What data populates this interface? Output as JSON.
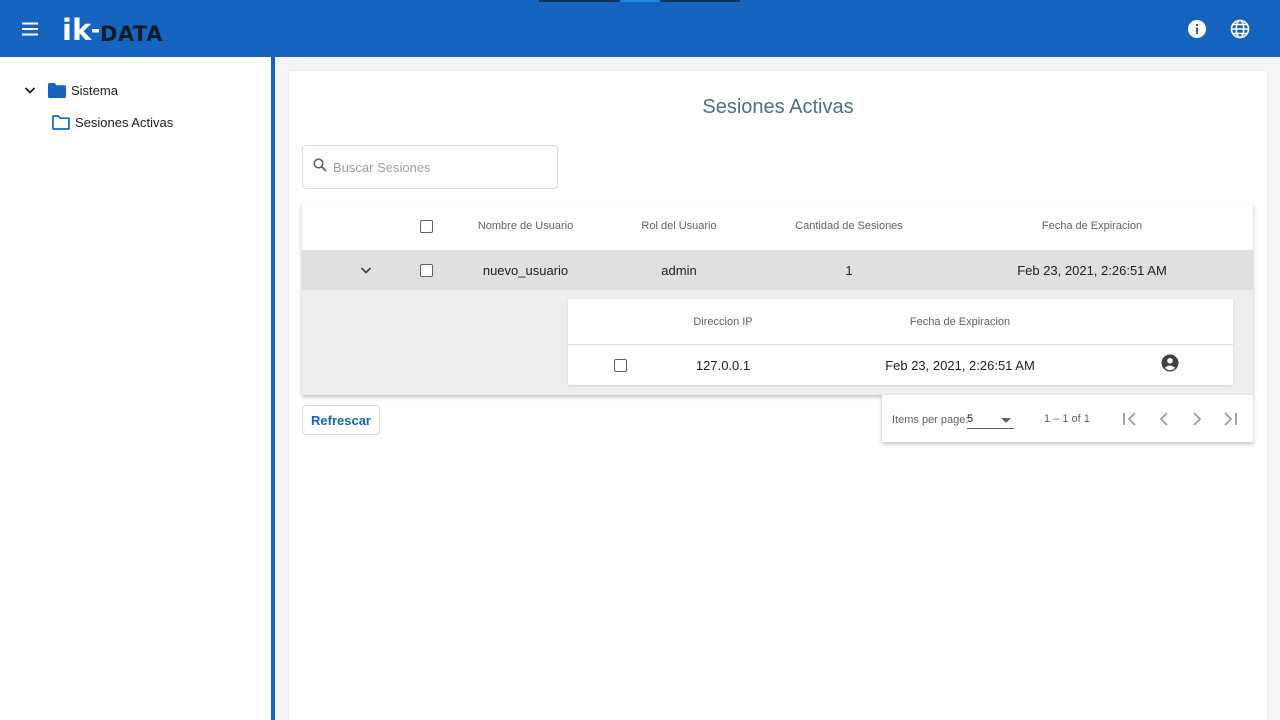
{
  "app": {
    "logo_text": "ik-DATA",
    "brand_color": "#1565c0",
    "icons": [
      "menu-icon",
      "info-icon",
      "globe-icon"
    ]
  },
  "sidebar": {
    "tree": [
      {
        "label": "Sistema",
        "icon": "folder-filled-icon",
        "expanded": true
      },
      {
        "label": "Sesiones Activas",
        "icon": "folder-outline-icon"
      }
    ]
  },
  "main": {
    "title": "Sesiones Activas",
    "search": {
      "placeholder": "Buscar Sesiones",
      "value": ""
    },
    "table": {
      "columns": [
        "Nombre de Usuario",
        "Rol del Usuario",
        "Cantidad de Sesiones",
        "Fecha de Expiracion"
      ],
      "rows": [
        {
          "username": "nuevo_usuario",
          "role": "admin",
          "sessions": "1",
          "expiration": "Feb 23, 2021, 2:26:51 AM"
        }
      ],
      "detail": {
        "columns": [
          "Direccion IP",
          "Fecha de Expiracion"
        ],
        "rows": [
          {
            "ip": "127.0.0.1",
            "expiration": "Feb 23, 2021, 2:26:51 AM",
            "action_icon": "account-circle-icon"
          }
        ]
      }
    },
    "refresh_label": "Refrescar",
    "paginator": {
      "items_per_page_label": "Items per page:",
      "page_size": "5",
      "range_label": "1 – 1 of 1"
    }
  }
}
